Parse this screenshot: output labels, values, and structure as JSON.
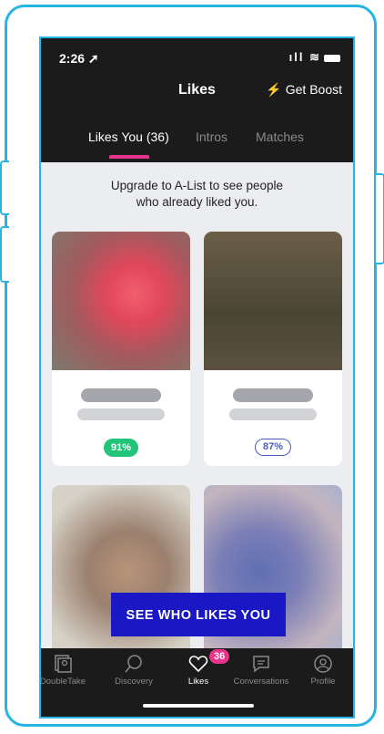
{
  "status": {
    "time": "2:26 ➚",
    "icons": "ıll ≋"
  },
  "header": {
    "title": "Likes",
    "boost_label": "⚡ Get Boost"
  },
  "tabs": [
    {
      "label": "Likes You (36)",
      "active": true
    },
    {
      "label": "Intros",
      "active": false
    },
    {
      "label": "Matches",
      "active": false
    }
  ],
  "upgrade": {
    "line1": "Upgrade to A-List to see people",
    "line2": "who already liked you."
  },
  "cards": [
    {
      "match": "91%",
      "match_color": "#22c47a"
    },
    {
      "match": "87%",
      "match_color": "#4a5bc4"
    },
    {
      "match": "",
      "match_color": ""
    },
    {
      "match": "",
      "match_color": ""
    }
  ],
  "cta": {
    "label": "SEE WHO LIKES YOU"
  },
  "nav": {
    "items": [
      {
        "label": "DoubleTake",
        "icon": "doubletake-icon"
      },
      {
        "label": "Discovery",
        "icon": "search-icon"
      },
      {
        "label": "Likes",
        "icon": "heart-icon"
      },
      {
        "label": "Conversations",
        "icon": "chat-icon"
      },
      {
        "label": "Profile",
        "icon": "profile-icon"
      }
    ],
    "likes_badge": "36"
  },
  "colors": {
    "accent_pink": "#e8348c",
    "cta_blue": "#1a18c4",
    "frame": "#26b5e3"
  }
}
